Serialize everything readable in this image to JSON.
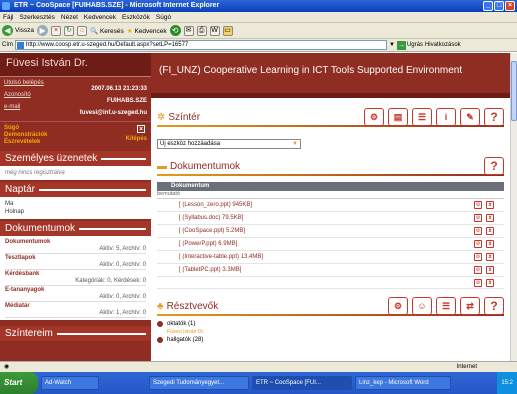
{
  "window": {
    "title": "ETR ~ CooSpace [FUIHABS.SZE] - Microsoft Internet Explorer"
  },
  "menu": [
    "Fájl",
    "Szerkesztés",
    "Nézet",
    "Kedvencek",
    "Eszközök",
    "Súgó"
  ],
  "toolbar": {
    "back": "Vissza",
    "search": "Keresés",
    "favorites": "Kedvencek"
  },
  "address": {
    "label": "Cím",
    "url": "http://www.coosp.etr.u-szeged.hu/Default.aspx?setLP=16577",
    "go": "Ugrás",
    "links": "Hivatkozások"
  },
  "sidebar": {
    "user": "Füvesi István Dr.",
    "last_login_label": "Utolsó belépés",
    "last_login": "2007.06.13 21:23:33",
    "id_label": "Azonosító",
    "id": "FUIHABS.SZE",
    "email_label": "e-mail",
    "email": "fuvesi@inf.u-szeged.hu",
    "links": [
      "Súgó",
      "Demonstrációk",
      "Észrevételek"
    ],
    "logout": "Kilépés",
    "messages_title": "Személyes üzenetek",
    "messages_empty": "még nincs regisztrálva",
    "calendar_title": "Naptár",
    "calendar_items": [
      "Ma",
      "Holnap"
    ],
    "modules_title": "Dokumentumok",
    "modules": [
      {
        "name": "Dokumentumok",
        "count": "Aktív: 5, Archív: 0"
      },
      {
        "name": "Tesztlapok",
        "count": "Aktív: 0, Archív: 0"
      },
      {
        "name": "Kérdésbank",
        "count": "Kategóriák: 0, Kérdések: 0"
      },
      {
        "name": "E-tananyagok",
        "count": "Aktív: 0, Archív: 0"
      },
      {
        "name": "Médiatár",
        "count": "Aktív: 1, Archív: 0"
      }
    ],
    "scenes_title": "Színtereim"
  },
  "main": {
    "course_title": "(FI_UNZ) Cooperative Learning in ICT Tools Supported Environment",
    "scene_title": "Színtér",
    "add_tool": "Új eszköz hozzáadása",
    "docs_title": "Dokumentumok",
    "docs_header": "Dokumentum",
    "docs_visible": "bemutató",
    "documents": [
      "[ (Lesson_zero.ppt) 945KB]",
      "[ (Syllabus.doc) 79.5KB]",
      "[ (CooSpace.ppt) 5.2MB]",
      "[ (PowerP.ppt) 6.9MB]",
      "[ (Interactive-table.ppt) 13.4MB]",
      "[ (TabletPC.ppt) 3.3MB]"
    ],
    "participants_title": "Résztvevők",
    "participants": [
      {
        "group": "oktatók (1)",
        "member": "Füvesi István Dr."
      },
      {
        "group": "hallgatók (28)",
        "member": ""
      }
    ],
    "help": "?"
  },
  "status": {
    "text": "",
    "zone": "Internet"
  },
  "taskbar": {
    "start": "Start",
    "tasks": [
      "Ad-Watch",
      "Szegedi Tudományegyet...",
      "ETR ~ CooSpace [FUI...",
      "Linz_kep - Microsoft Word"
    ],
    "clock": "15:2"
  }
}
